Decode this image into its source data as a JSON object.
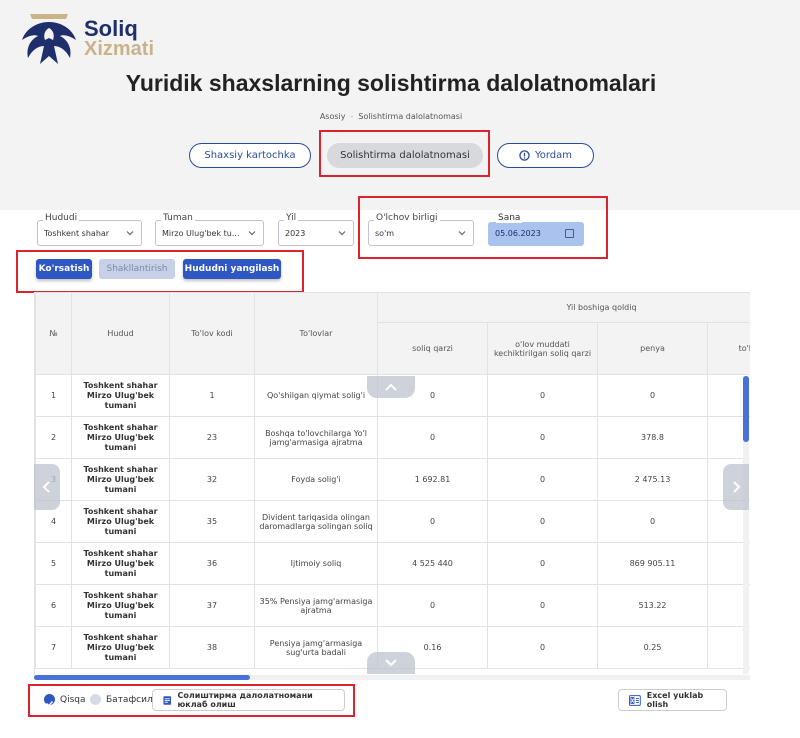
{
  "brand": {
    "line1": "Soliq",
    "line2": "Xizmati"
  },
  "page_title": "Yuridik shaxslarning solishtirma dalolatnomalari",
  "breadcrumb": [
    "Asosiy",
    "Solishtirma dalolatnomasi"
  ],
  "nav": {
    "personal_card": "Shaxsiy kartochka",
    "comparison": "Solishtirma dalolatnomasi",
    "help": "Yordam"
  },
  "filters": {
    "region": {
      "label": "Hududi",
      "value": "Toshkent shahar"
    },
    "district": {
      "label": "Tuman",
      "value": "Mirzo Ulug'bek tu..."
    },
    "year": {
      "label": "Yil",
      "value": "2023"
    },
    "unit": {
      "label": "O'lchov birligi",
      "value": "so'm"
    },
    "date": {
      "label": "Sana",
      "value": "05.06.2023"
    }
  },
  "actions": {
    "show": "Ko'rsatish",
    "generate": "Shakllantirish",
    "update_region": "Hududni yangilash"
  },
  "table": {
    "headers": {
      "num": "№",
      "hudud": "Hudud",
      "code": "To'lov kodi",
      "payments": "To'lovlar",
      "group": "Yil boshiga qoldiq",
      "tax_debt": "soliq qarzi",
      "overdue": "o'lov muddati kechiktirilgan soliq qarzi",
      "penya": "penya",
      "extra": "to'l... kechik..."
    },
    "rows": [
      {
        "num": "1",
        "hudud": "Toshkent shahar Mirzo Ulug'bek tumani",
        "code": "1",
        "payment": "Qo'shilgan qiymat solig'i",
        "debt": "0",
        "overdue": "0",
        "penya": "0"
      },
      {
        "num": "2",
        "hudud": "Toshkent shahar Mirzo Ulug'bek tumani",
        "code": "23",
        "payment": "Boshqa to'lovchilarga Yo'l jamg'armasiga ajratma",
        "debt": "0",
        "overdue": "0",
        "penya": "378.8"
      },
      {
        "num": "3",
        "hudud": "Toshkent shahar Mirzo Ulug'bek tumani",
        "code": "32",
        "payment": "Foyda solig'i",
        "debt": "1 692.81",
        "overdue": "0",
        "penya": "2 475.13"
      },
      {
        "num": "4",
        "hudud": "Toshkent shahar Mirzo Ulug'bek tumani",
        "code": "35",
        "payment": "Divident tariqasida olingan daromadlarga solingan soliq",
        "debt": "0",
        "overdue": "0",
        "penya": "0"
      },
      {
        "num": "5",
        "hudud": "Toshkent shahar Mirzo Ulug'bek tumani",
        "code": "36",
        "payment": "Ijtimoiy soliq",
        "debt": "4 525 440",
        "overdue": "0",
        "penya": "869 905.11"
      },
      {
        "num": "6",
        "hudud": "Toshkent shahar Mirzo Ulug'bek tumani",
        "code": "37",
        "payment": "35% Pensiya jamg'armasiga ajratma",
        "debt": "0",
        "overdue": "0",
        "penya": "513.22"
      },
      {
        "num": "7",
        "hudud": "Toshkent shahar Mirzo Ulug'bek tumani",
        "code": "38",
        "payment": "Pensiya jamg'armasiga sug'urta badali",
        "debt": "0.16",
        "overdue": "0",
        "penya": "0.25"
      }
    ]
  },
  "footer": {
    "brief": "Qisqa",
    "detailed": "Батафсил",
    "print": "Солиштирма далолатномани юклаб олиш",
    "excel": "Excel yuklab olish"
  },
  "colors": {
    "primary": "#2e57c4",
    "highlight": "#d9232e",
    "brand_navy": "#1f2f6b",
    "brand_gold": "#c9b48a"
  }
}
